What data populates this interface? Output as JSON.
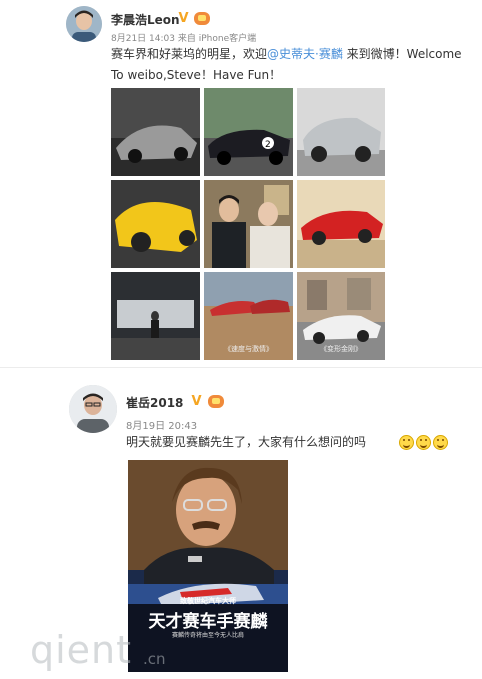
{
  "post1": {
    "author": "李晨浩Leon",
    "time": "8月21日 14:03",
    "source": "来自 iPhone客户端",
    "text_before": "赛车界和好莱坞的明星，欢迎",
    "mention": "@史蒂夫·赛麟",
    "text_after": " 来到微博！Welcome To weibo,Steve！Have Fun！",
    "images": [
      {
        "caption": ""
      },
      {
        "caption": ""
      },
      {
        "caption": ""
      },
      {
        "caption": ""
      },
      {
        "caption": ""
      },
      {
        "caption": ""
      },
      {
        "caption": ""
      },
      {
        "caption": "《速度与激情》"
      },
      {
        "caption": "《变形金刚》"
      }
    ]
  },
  "post2": {
    "author": "崔岳2018",
    "time": "8月19日 20:43",
    "text": "明天就要见赛麟先生了，大家有什么想问的吗",
    "poster": {
      "line1": "致敬世纪汽车大师",
      "title": "天才赛车手赛麟",
      "line3": "赛麟传奇将由至今无人比肩"
    }
  },
  "watermark": {
    "main": "qient",
    "domain": ".cn"
  },
  "colors": {
    "mention": "#4a8fd8",
    "verified": "#f5a623"
  }
}
